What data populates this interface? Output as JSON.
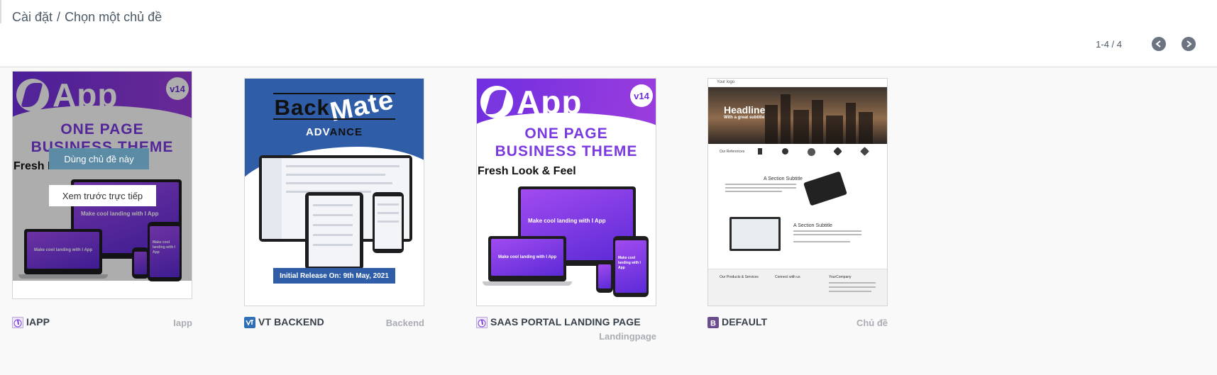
{
  "breadcrumb": {
    "parent": "Cài đặt",
    "separator": "/",
    "current": "Chọn một chủ đề"
  },
  "pager": {
    "value": "1-4 / 4",
    "prev_icon": "chevron-left-icon",
    "next_icon": "chevron-right-icon"
  },
  "hover_actions": {
    "use_label": "Dùng chủ đề này",
    "preview_label": "Xem trước trực tiếp"
  },
  "themes": [
    {
      "name": "IAPP",
      "category": "Iapp",
      "icon": "iapp-module-icon",
      "thumb": {
        "logo": "App",
        "version": "v14",
        "line1": "ONE PAGE",
        "line2": "BUSINESS THEME",
        "tagline": "Fresh Look & Feel",
        "screen_text": "Make cool landing with I App",
        "phone_text": "Make cool landing with I App"
      }
    },
    {
      "name": "VT BACKEND",
      "category": "Backend",
      "icon": "vt-backend-module-icon",
      "thumb": {
        "title_a": "Back",
        "title_b": "Mate",
        "subtitle_a": "ADV",
        "subtitle_b": "ANCE",
        "release": "Initial Release On: 9th May, 2021"
      }
    },
    {
      "name": "SAAS PORTAL LANDING PAGE",
      "category": "Landingpage",
      "icon": "saas-module-icon",
      "thumb": {
        "logo": "App",
        "version": "v14",
        "line1": "ONE PAGE",
        "line2": "BUSINESS THEME",
        "tagline": "Fresh Look & Feel",
        "screen_text": "Make cool landing with I App",
        "phone_text": "Make cool landing with I App"
      }
    },
    {
      "name": "DEFAULT",
      "category": "Chủ đề",
      "icon": "default-module-icon",
      "thumb": {
        "logo": "Your logo",
        "headline": "Headline",
        "subtitle": "With a great subtitle",
        "references": "Our References",
        "section1": "A Section Subtitle",
        "section2": "A Section Subtitle",
        "footer1": "Our Products & Services",
        "footer2": "Connect with us",
        "footer3": "YourCompany"
      }
    }
  ],
  "colors": {
    "iapp_purple": "#7b3ae0",
    "backmate_blue": "#2f5da8",
    "use_button": "#5c8ba6",
    "default_icon": "#6b4c8f",
    "vt_icon": "#2f6fb8"
  }
}
